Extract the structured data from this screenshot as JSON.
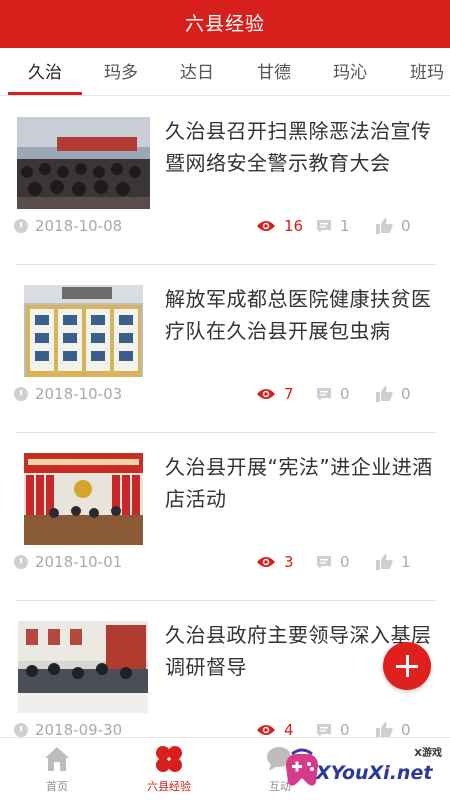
{
  "header": {
    "title": "六县经验"
  },
  "tabs": [
    {
      "label": "久治",
      "active": true
    },
    {
      "label": "玛多",
      "active": false
    },
    {
      "label": "达日",
      "active": false
    },
    {
      "label": "甘德",
      "active": false
    },
    {
      "label": "玛沁",
      "active": false
    },
    {
      "label": "班玛",
      "active": false
    }
  ],
  "articles": [
    {
      "title": "久治县召开扫黑除恶法治宣传暨网络安全警示教育大会",
      "date": "2018-10-08",
      "views": "16",
      "comments": "1",
      "likes": "0"
    },
    {
      "title": "解放军成都总医院健康扶贫医疗队在久治县开展包虫病",
      "date": "2018-10-03",
      "views": "7",
      "comments": "0",
      "likes": "0"
    },
    {
      "title": "久治县开展“宪法”进企业进酒店活动",
      "date": "2018-10-01",
      "views": "3",
      "comments": "0",
      "likes": "1"
    },
    {
      "title": "久治县政府主要领导深入基层调研督导",
      "date": "2018-09-30",
      "views": "4",
      "comments": "0",
      "likes": "0"
    }
  ],
  "bottom_nav": [
    {
      "label": "首页",
      "icon": "home-icon",
      "active": false
    },
    {
      "label": "六县经验",
      "icon": "flower-icon",
      "active": true
    },
    {
      "label": "互动",
      "icon": "chat-icon",
      "active": false
    }
  ],
  "watermark": {
    "small": "X游戏",
    "big": "XYouXi.net"
  },
  "colors": {
    "brand": "#d7201c",
    "muted": "#aaaaaa"
  }
}
